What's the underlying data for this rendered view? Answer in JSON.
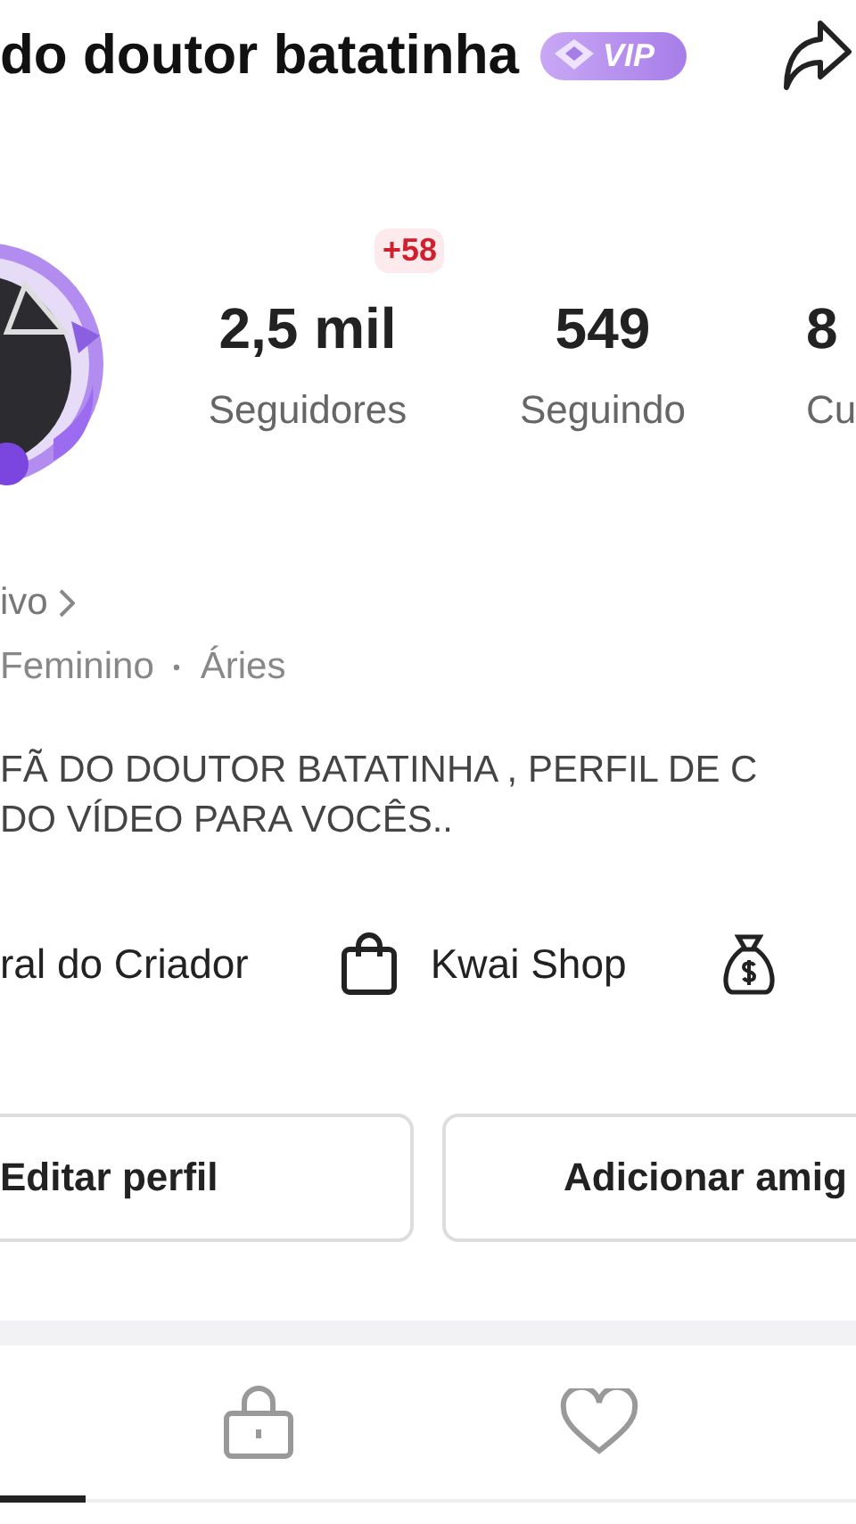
{
  "header": {
    "name": "do doutor batatinha",
    "badge": "VIP"
  },
  "stats": [
    {
      "value": "2,5 mil",
      "label": "Seguidores",
      "delta": "+58"
    },
    {
      "value": "549",
      "label": "Seguindo"
    },
    {
      "value": "8",
      "label": "Cu"
    }
  ],
  "live_link": "ivo",
  "details": [
    "Feminino",
    "Áries"
  ],
  "bio": [
    "FÃ DO DOUTOR BATATINHA , PERFIL DE C",
    "DO VÍDEO PARA VOCÊS.."
  ],
  "shortcuts": [
    {
      "kind": "none",
      "label": "ral do Criador"
    },
    {
      "kind": "bag",
      "label": "Kwai Shop"
    },
    {
      "kind": "moneybag"
    }
  ],
  "buttons": [
    "Editar perfil",
    "Adicionar amig"
  ],
  "tabs": [
    {
      "kind": "none",
      "selected": true
    },
    {
      "kind": "lock",
      "selected": false
    },
    {
      "kind": "heart",
      "selected": false
    }
  ]
}
